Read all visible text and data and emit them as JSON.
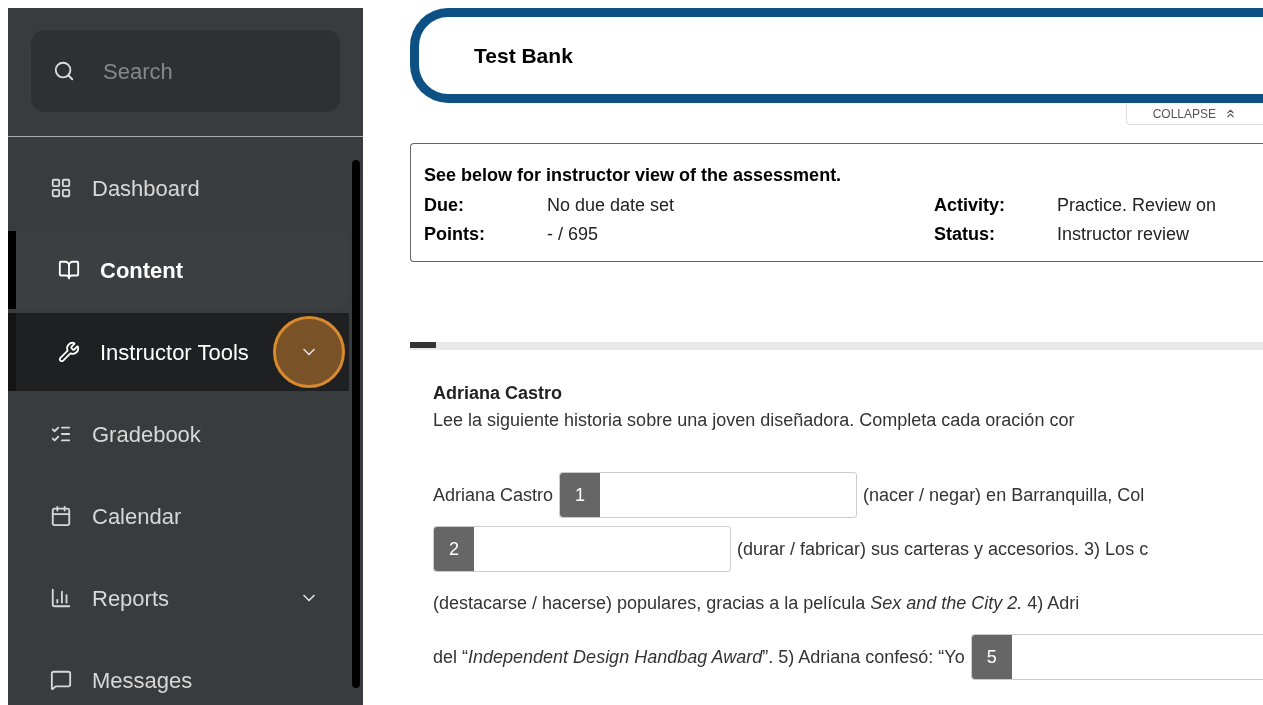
{
  "sidebar": {
    "search": {
      "placeholder": "Search"
    },
    "items": [
      {
        "label": "Dashboard",
        "selected": false,
        "focused": false,
        "has_submenu": false
      },
      {
        "label": "Content",
        "selected": true,
        "focused": false,
        "has_submenu": false
      },
      {
        "label": "Instructor Tools",
        "selected": false,
        "focused": true,
        "has_submenu": true
      },
      {
        "label": "Gradebook",
        "selected": false,
        "focused": false,
        "has_submenu": false
      },
      {
        "label": "Calendar",
        "selected": false,
        "focused": false,
        "has_submenu": false
      },
      {
        "label": "Reports",
        "selected": false,
        "focused": false,
        "has_submenu": true
      },
      {
        "label": "Messages",
        "selected": false,
        "focused": false,
        "has_submenu": false
      }
    ]
  },
  "header": {
    "title": "Test Bank",
    "collapse": "COLLAPSE"
  },
  "info": {
    "heading": "See below for instructor view of the assessment.",
    "fields": [
      {
        "label": "Due:",
        "value": "No due date set"
      },
      {
        "label": "Activity:",
        "value": "Practice. Review on"
      },
      {
        "label": "Points:",
        "value": "- / 695"
      },
      {
        "label": "Status:",
        "value": "Instructor review"
      }
    ]
  },
  "question": {
    "level": 0.03,
    "title": "Adriana Castro",
    "instructions": "Lee la siguiente historia sobre una joven diseñadora. Completa cada oración cor",
    "lines": [
      [
        {
          "kind": "text",
          "text": "Adriana Castro"
        },
        {
          "kind": "blank",
          "number": "1"
        },
        {
          "kind": "text",
          "text": "(nacer / negar) en Barranquilla, Col"
        }
      ],
      [
        {
          "kind": "blank",
          "number": "2"
        },
        {
          "kind": "text",
          "text": "(durar / fabricar) sus carteras y accesorios. 3) Los c"
        }
      ],
      [
        {
          "kind": "text",
          "text": "(destacarse / hacerse) populares, gracias a la película *Sex and the City 2.* 4) Adri"
        }
      ],
      [
        {
          "kind": "text",
          "text": "del “*Independent Design Handbag Award*”. 5) Adriana confesó: “Yo"
        },
        {
          "kind": "blank",
          "number": "5"
        }
      ]
    ]
  }
}
